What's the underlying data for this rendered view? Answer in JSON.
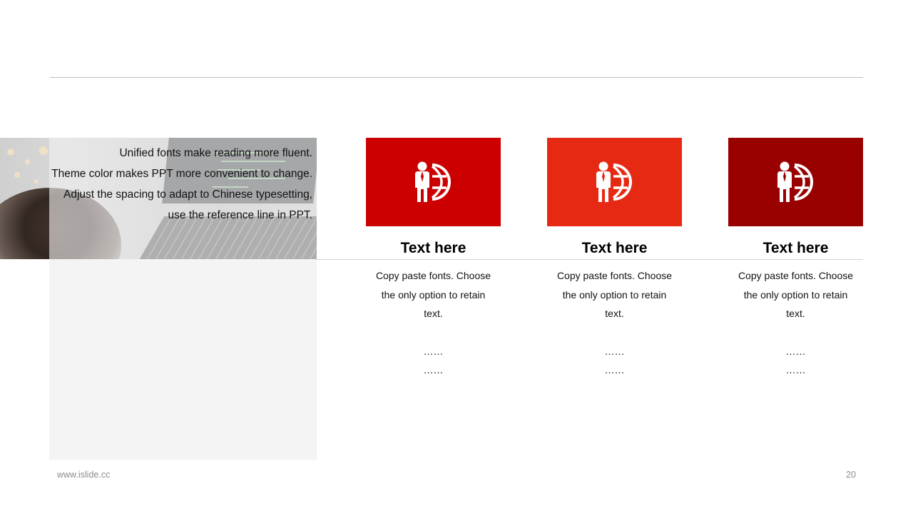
{
  "intro": {
    "lines": [
      "Unified fonts make reading more fluent.",
      "Theme color makes PPT more convenient to change.",
      "Adjust the spacing to adapt to Chinese typesetting, use the reference line in PPT."
    ]
  },
  "cards": [
    {
      "color": "#CC0000",
      "icon": "businessman-globe-icon",
      "title": "Text here",
      "body": "Copy paste fonts. Choose the only option to retain text.",
      "dots": [
        "……",
        "……"
      ]
    },
    {
      "color": "#E62912",
      "icon": "businessman-globe-icon",
      "title": "Text here",
      "body": "Copy paste fonts. Choose the only option to retain text.",
      "dots": [
        "……",
        "……"
      ]
    },
    {
      "color": "#990000",
      "icon": "businessman-globe-icon",
      "title": "Text here",
      "body": "Copy paste fonts. Choose the only option to retain text.",
      "dots": [
        "……",
        "……"
      ]
    }
  ],
  "footer": {
    "url": "www.islide.cc",
    "page_number": "20"
  }
}
